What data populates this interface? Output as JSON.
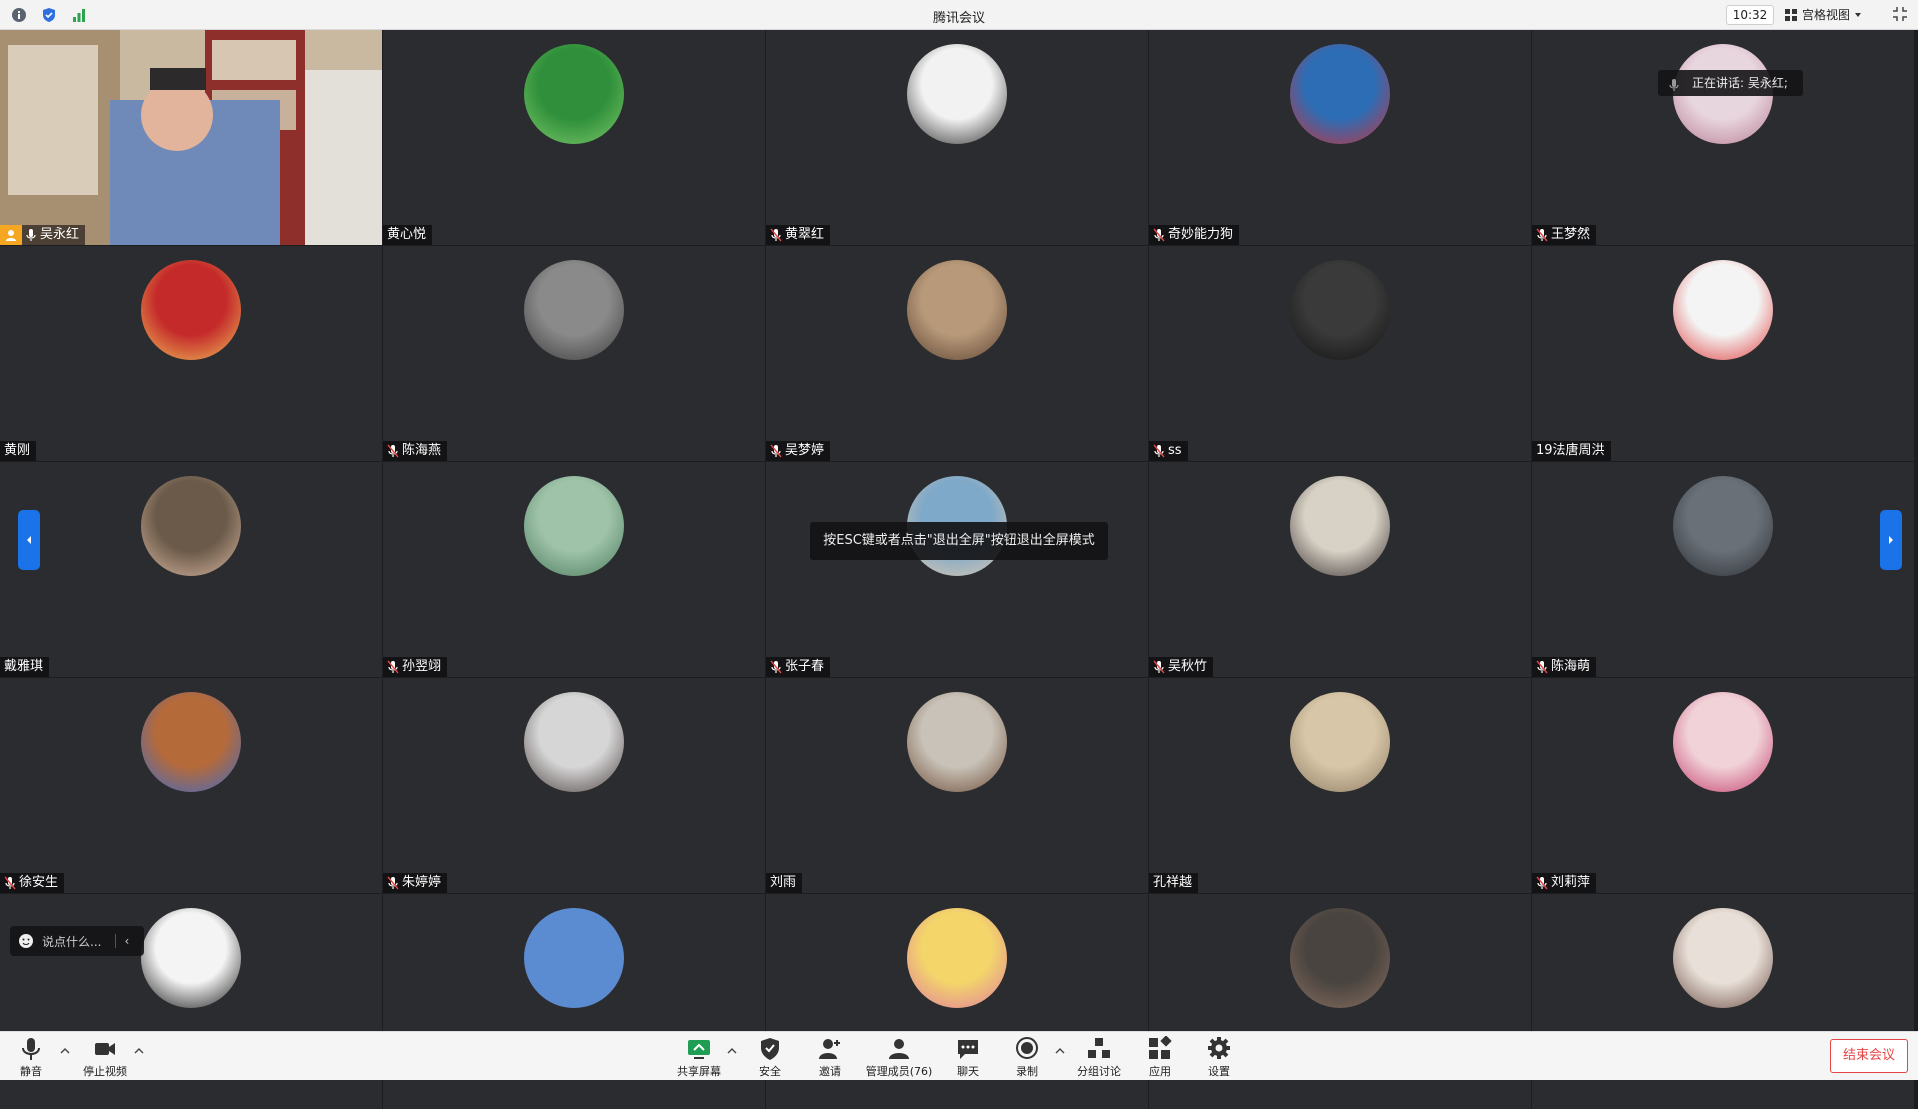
{
  "app": {
    "title": "腾讯会议",
    "time": "10:32",
    "view_label": "宫格视图"
  },
  "participants": [
    {
      "name": "吴永红",
      "self": true
    },
    {
      "name": "黄心悦",
      "mic": false
    },
    {
      "name": "黄翠红",
      "mic": true
    },
    {
      "name": "奇妙能力狗",
      "mic": true
    },
    {
      "name": "王梦然",
      "mic": true
    },
    {
      "name": "黄刚",
      "mic": false
    },
    {
      "name": "陈海燕",
      "mic": true
    },
    {
      "name": "吴梦婷",
      "mic": true
    },
    {
      "name": "ss",
      "mic": true
    },
    {
      "name": "19法唐周洪",
      "mic": false
    },
    {
      "name": "戴雅琪",
      "mic": false
    },
    {
      "name": "孙翌翊",
      "mic": true
    },
    {
      "name": "张子春",
      "mic": true
    },
    {
      "name": "吴秋竹",
      "mic": true
    },
    {
      "name": "陈海萌",
      "mic": true
    },
    {
      "name": "徐安生",
      "mic": true
    },
    {
      "name": "朱婷婷",
      "mic": true
    },
    {
      "name": "刘雨",
      "mic": false
    },
    {
      "name": "孔祥越",
      "mic": false
    },
    {
      "name": "刘莉萍",
      "mic": true
    },
    {
      "name": "",
      "mic": false
    },
    {
      "name": "",
      "mic": false
    },
    {
      "name": "",
      "mic": false
    },
    {
      "name": "",
      "mic": false
    },
    {
      "name": "",
      "mic": false
    }
  ],
  "overlays": {
    "toast": "按ESC键或者点击\"退出全屏\"按钮退出全屏模式",
    "speaking": "正在讲话: 吴永红;",
    "chat_placeholder": "说点什么..."
  },
  "toolbar": {
    "mute": "静音",
    "stop_video": "停止视频",
    "share": "共享屏幕",
    "security": "安全",
    "invite": "邀请",
    "members": "管理成员(76)",
    "chat": "聊天",
    "record": "录制",
    "breakout": "分组讨论",
    "apps": "应用",
    "settings": "设置",
    "end": "结束会议"
  },
  "colors": {
    "accent": "#1a73e8",
    "end": "#e64545",
    "tile": "#2b2c30",
    "self_badge": "#f5a623"
  }
}
